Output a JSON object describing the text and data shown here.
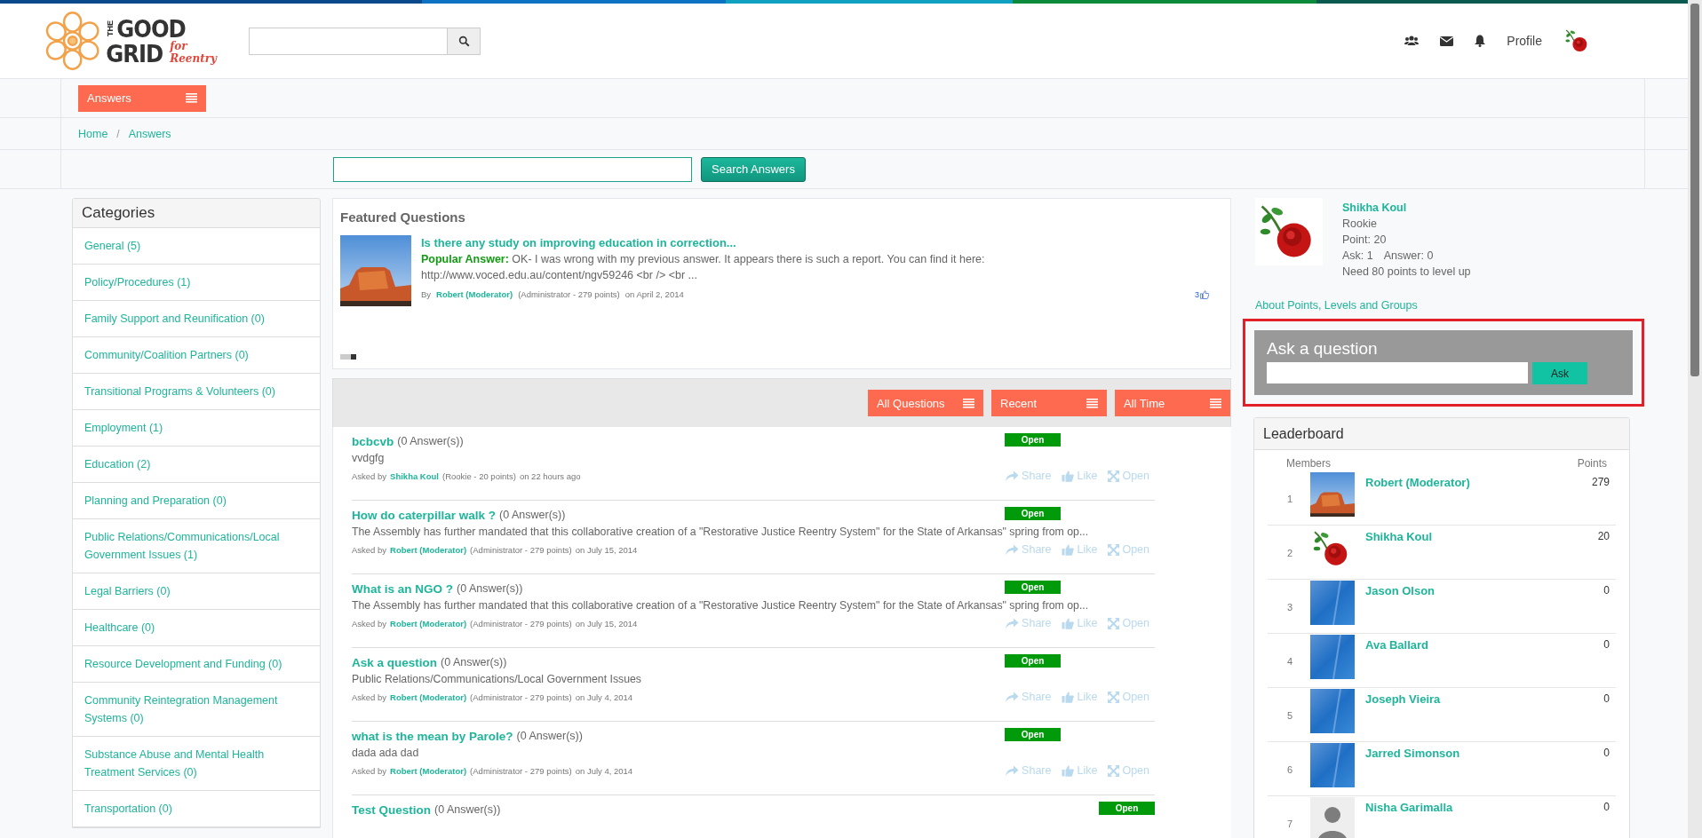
{
  "header": {
    "logo": {
      "small_word": "THE",
      "words": [
        "GOOD",
        "GRID"
      ],
      "tagline": "for Reentry"
    },
    "profile_label": "Profile"
  },
  "nav": {
    "menu_button": "Answers"
  },
  "breadcrumb": {
    "items": [
      "Home",
      "Answers"
    ],
    "separator": "/"
  },
  "answer_search": {
    "button": "Search Answers"
  },
  "categories": {
    "title": "Categories",
    "items": [
      {
        "label": "General (5)"
      },
      {
        "label": "Policy/Procedures (1)"
      },
      {
        "label": "Family Support and Reunification (0)"
      },
      {
        "label": "Community/Coalition Partners (0)"
      },
      {
        "label": "Transitional Programs & Volunteers (0)"
      },
      {
        "label": "Employment (1)"
      },
      {
        "label": "Education (2)"
      },
      {
        "label": "Planning and Preparation (0)"
      },
      {
        "label": "Public Relations/Communications/Local Government Issues (1)"
      },
      {
        "label": "Legal Barriers (0)"
      },
      {
        "label": "Healthcare (0)"
      },
      {
        "label": "Resource Development and Funding (0)"
      },
      {
        "label": "Community Reintegration Management Systems (0)"
      },
      {
        "label": "Substance Abuse and Mental Health Treatment Services (0)"
      },
      {
        "label": "Transportation (0)"
      }
    ]
  },
  "featured": {
    "title": "Featured Questions",
    "question": "Is there any study on improving education in correction...",
    "answer_label": "Popular Answer:",
    "answer_text": "OK- I was wrong with my previous answer. It appears there is such a report. You can find it here: http://www.voced.edu.au/content/ngv59246 <br /> <br ...",
    "by_label": "By",
    "author": "Robert (Moderator)",
    "author_info": "(Administrator - 279 points)",
    "date": "on April 2, 2014",
    "likes": "3",
    "slides": [
      {
        "selected": false
      },
      {
        "selected": false
      },
      {
        "selected": true
      }
    ]
  },
  "filters": [
    {
      "label": "All Questions"
    },
    {
      "label": "Recent"
    },
    {
      "label": "All Time"
    }
  ],
  "questions": [
    {
      "title": "bcbcvb",
      "answers": "(0 Answer(s))",
      "excerpt": "vvdgfg",
      "asked_by": "Asked by",
      "author": "Shikha Koul",
      "author_info": "(Rookie - 20 points)",
      "date": "on 22 hours ago",
      "status": "Open",
      "actions": [
        "Share",
        "Like",
        "Open"
      ]
    },
    {
      "title": "How do caterpillar walk ?",
      "answers": "(0 Answer(s))",
      "excerpt": "The Assembly has further mandated that this collaborative creation of a \"Restorative Justice Reentry System\" for the State of Arkansas\" spring from op...",
      "asked_by": "Asked by",
      "author": "Robert (Moderator)",
      "author_info": "(Administrator - 279 points)",
      "date": "on July 15, 2014",
      "status": "Open",
      "actions": [
        "Share",
        "Like",
        "Open"
      ]
    },
    {
      "title": "What is an NGO ?",
      "answers": "(0 Answer(s))",
      "excerpt": "The Assembly has further mandated that this collaborative creation of a \"Restorative Justice Reentry System\" for the State of Arkansas\" spring from op...",
      "asked_by": "Asked by",
      "author": "Robert (Moderator)",
      "author_info": "(Administrator - 279 points)",
      "date": "on July 15, 2014",
      "status": "Open",
      "actions": [
        "Share",
        "Like",
        "Open"
      ]
    },
    {
      "title": "Ask a question",
      "answers": "(0 Answer(s))",
      "excerpt": "Public Relations/Communications/Local Government Issues",
      "asked_by": "Asked by",
      "author": "Robert (Moderator)",
      "author_info": "(Administrator - 279 points)",
      "date": "on July 4, 2014",
      "status": "Open",
      "actions": [
        "Share",
        "Like",
        "Open"
      ]
    },
    {
      "title": "what is the mean by Parole?",
      "answers": "(0 Answer(s))",
      "excerpt": "dada ada dad",
      "asked_by": "Asked by",
      "author": "Robert (Moderator)",
      "author_info": "(Administrator - 279 points)",
      "date": "on July 4, 2014",
      "status": "Open",
      "actions": [
        "Share",
        "Like",
        "Open"
      ]
    },
    {
      "title": "Test Question",
      "answers": "(0 Answer(s))",
      "status": "Open"
    }
  ],
  "profile": {
    "name": "Shikha Koul",
    "rank": "Rookie",
    "points": "Point: 20",
    "ask": "Ask: 1",
    "answer": "Answer: 0",
    "need": "Need 80 points to level up",
    "link": "About Points, Levels and Groups"
  },
  "ask_box": {
    "title": "Ask a question",
    "button": "Ask",
    "highlighted": true
  },
  "leaderboard": {
    "title": "Leaderboard",
    "columns": [
      "Members",
      "Points"
    ],
    "rows": [
      {
        "rank": "1",
        "kind": "photo",
        "name": "Robert (Moderator)",
        "points": "279"
      },
      {
        "rank": "2",
        "kind": "rose",
        "name": "Shikha Koul",
        "points": "20"
      },
      {
        "rank": "3",
        "kind": "blue",
        "name": "Jason Olson",
        "points": "0"
      },
      {
        "rank": "4",
        "kind": "blue",
        "name": "Ava Ballard",
        "points": "0"
      },
      {
        "rank": "5",
        "kind": "blue",
        "name": "Joseph Vieira",
        "points": "0"
      },
      {
        "rank": "6",
        "kind": "blue",
        "name": "Jarred Simonson",
        "points": "0"
      },
      {
        "rank": "7",
        "kind": "silhouette",
        "name": "Nisha Garimalla",
        "points": "0"
      }
    ]
  }
}
